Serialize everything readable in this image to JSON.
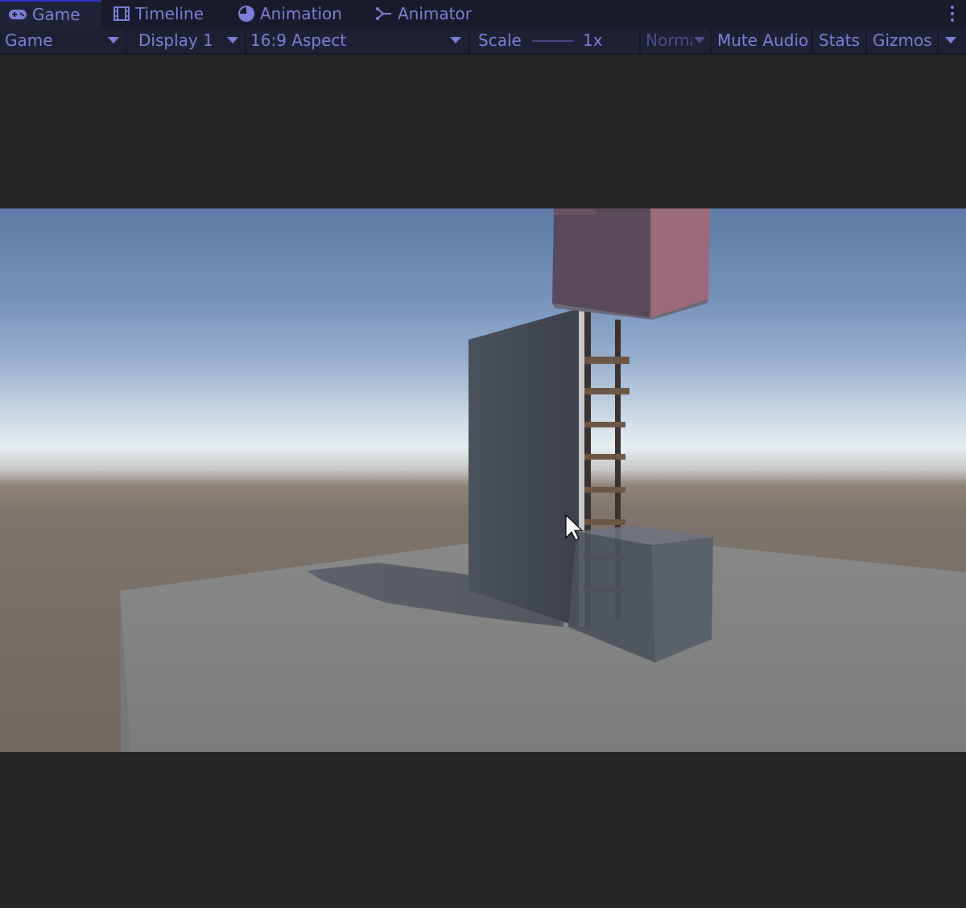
{
  "tabs": [
    {
      "label": "Game",
      "icon": "gamepad-icon",
      "active": true
    },
    {
      "label": "Timeline",
      "icon": "film-icon",
      "active": false
    },
    {
      "label": "Animation",
      "icon": "clock-icon",
      "active": false
    },
    {
      "label": "Animator",
      "icon": "animator-branch-icon",
      "active": false
    }
  ],
  "toolbar": {
    "view_mode": "Game",
    "display": "Display 1",
    "aspect": "16:9 Aspect",
    "scale_label": "Scale",
    "scale_value": "1x",
    "play_mode": "Norma",
    "mute_audio": "Mute Audio",
    "stats": "Stats",
    "gizmos": "Gizmos"
  },
  "colors": {
    "accent": "#7b80d6",
    "tab_bg": "#191a2c",
    "toolbar_bg": "#1e2036",
    "panel_bg": "#262626",
    "active_tab_border": "#2c37c9"
  },
  "scene": {
    "objects": [
      "sky",
      "ground",
      "platform",
      "tall-wall",
      "ladder",
      "red-block",
      "glass-cube",
      "shadow"
    ]
  }
}
